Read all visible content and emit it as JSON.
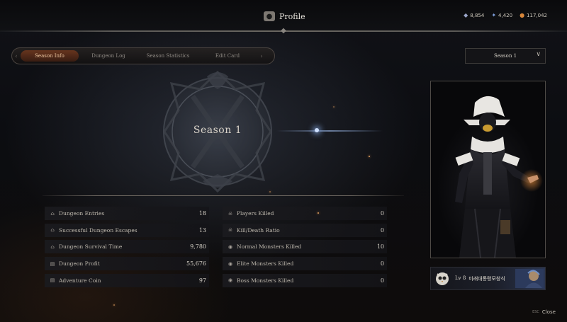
{
  "header": {
    "title": "Profile",
    "currencies": [
      {
        "icon": "gem-icon",
        "value": "8,854"
      },
      {
        "icon": "shard-icon",
        "value": "4,420"
      },
      {
        "icon": "gold-coin-icon",
        "value": "117,042"
      }
    ]
  },
  "tabs": [
    {
      "label": "Season Info",
      "active": true
    },
    {
      "label": "Dungeon Log",
      "active": false
    },
    {
      "label": "Season Statistics",
      "active": false
    },
    {
      "label": "Edit Card",
      "active": false
    }
  ],
  "season_select": {
    "value": "Season 1"
  },
  "emblem": {
    "title": "Season 1"
  },
  "stats_left": [
    {
      "icon": "dungeon-gate-icon",
      "label": "Dungeon Entries",
      "value": "18"
    },
    {
      "icon": "dungeon-gate-icon",
      "label": "Successful Dungeon Escapes",
      "value": "13"
    },
    {
      "icon": "dungeon-gate-icon",
      "label": "Dungeon Survival Time",
      "value": "9,780"
    },
    {
      "icon": "treasure-chest-icon",
      "label": "Dungeon Profit",
      "value": "55,676"
    },
    {
      "icon": "treasure-chest-icon",
      "label": "Adventure Coin",
      "value": "97"
    }
  ],
  "stats_right": [
    {
      "icon": "skull-icon",
      "label": "Players Killed",
      "value": "0"
    },
    {
      "icon": "skull-icon",
      "label": "Kill/Death Ratio",
      "value": "0"
    },
    {
      "icon": "monster-icon",
      "label": "Normal Monsters Killed",
      "value": "10"
    },
    {
      "icon": "monster-icon",
      "label": "Elite Monsters Killed",
      "value": "0"
    },
    {
      "icon": "monster-icon",
      "label": "Boss Monsters Killed",
      "value": "0"
    }
  ],
  "player_card": {
    "level": "Lv 8",
    "name": "미래대통령모창식"
  },
  "footer": {
    "key": "ESC",
    "label": "Close"
  },
  "colors": {
    "accent": "#f0c9a2",
    "active_tab_bg": "#6e371e",
    "panel_bg": "#1a1a1e",
    "background": "#0c0d11"
  }
}
